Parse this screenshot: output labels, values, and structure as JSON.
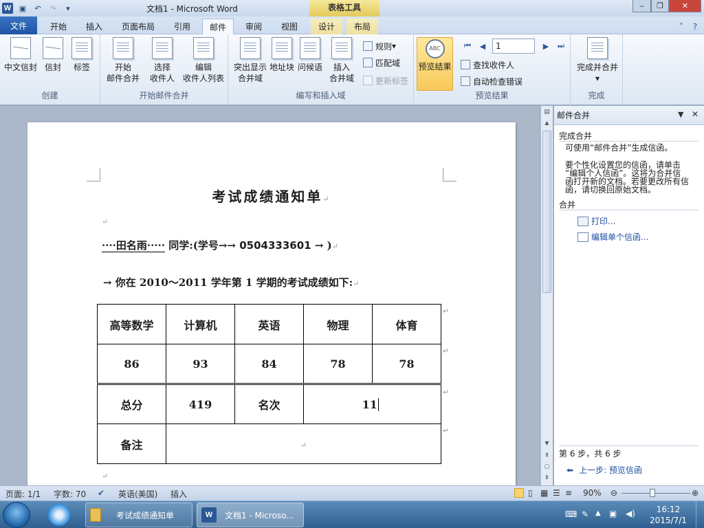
{
  "window": {
    "title": "文档1 - Microsoft Word",
    "context_tab_group": "表格工具"
  },
  "tabs": [
    "文件",
    "开始",
    "插入",
    "页面布局",
    "引用",
    "邮件",
    "审阅",
    "视图",
    "设计",
    "布局"
  ],
  "active_tab": "邮件",
  "ribbon": {
    "groups": {
      "create": "创建",
      "start_merge": "开始邮件合并",
      "write_insert": "编写和插入域",
      "preview": "预览结果",
      "finish": "完成"
    },
    "buttons": {
      "chinese_envelope": "中文信封",
      "envelope": "信封",
      "labels": "标签",
      "start_merge_1": "开始",
      "start_merge_2": "邮件合并",
      "select_recipients_1": "选择",
      "select_recipients_2": "收件人",
      "edit_list_1": "编辑",
      "edit_list_2": "收件人列表",
      "highlight_1": "突出显示",
      "highlight_2": "合并域",
      "address_block": "地址块",
      "greeting": "问候语",
      "insert_field_1": "插入",
      "insert_field_2": "合并域",
      "rules": "规则",
      "match_fields": "匹配域",
      "update_labels": "更新标签",
      "preview_results": "预览结果",
      "find_recipient": "查找收件人",
      "auto_check": "自动检查错误",
      "finish_merge": "完成并合并"
    },
    "record_number": "1"
  },
  "document": {
    "title": "考试成绩通知单",
    "student_name": "····田名雨·····",
    "greeting_mid": "同学:(学号→→",
    "student_id": "0504333601",
    "greeting_end": "→ )",
    "intro_line": "→ 你在 2010～2011 学年第 1 学期的考试成绩如下:",
    "table": {
      "subjects": [
        "高等数学",
        "计算机",
        "英语",
        "物理",
        "体育"
      ],
      "scores": [
        "86",
        "93",
        "84",
        "78",
        "78"
      ],
      "total_label": "总分",
      "total_value": "419",
      "rank_label": "名次",
      "rank_value": "11",
      "remarks_label": "备注",
      "remarks_value": ""
    }
  },
  "task_pane": {
    "title": "邮件合并",
    "section_complete": "完成合并",
    "text1": "可使用“邮件合并”生成信函。",
    "text2_lines": [
      "要个性化设置您的信函，请单击",
      "“编辑个人信函”。这将为合并信",
      "函打开新的文档。若要更改所有信",
      "函，请切换回原始文档。"
    ],
    "section_merge": "合并",
    "link_print": "打印...",
    "link_edit_letters": "编辑单个信函...",
    "step_text": "第 6 步，共 6 步",
    "prev_step": "上一步: 预览信函"
  },
  "status_bar": {
    "page": "页面: 1/1",
    "words": "字数: 70",
    "language": "英语(美国)",
    "mode": "插入",
    "zoom": "90%"
  },
  "taskbar": {
    "task1": "考试成绩通知单",
    "task2": "文档1 - Microso...",
    "time": "16:12",
    "date": "2015/7/1"
  },
  "colors": {
    "file_tab": "#2b5797",
    "preview_active": "#f9c95a",
    "taskbar": "#2f5f91"
  }
}
